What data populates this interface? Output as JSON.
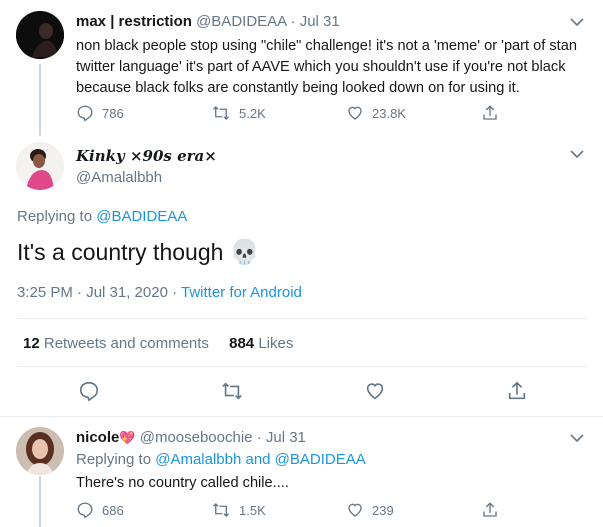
{
  "tweet1": {
    "name": "max | restriction",
    "handle": "@BADIDEAA",
    "dot": "·",
    "date": "Jul 31",
    "text": "non black people stop using \"chile\" challenge! it's not a 'meme' or 'part of stan twitter language' it's part of AAVE which you shouldn't use if you're not black because black folks are constantly being looked down on for using it.",
    "replies": "786",
    "retweets": "5.2K",
    "likes": "23.8K"
  },
  "main": {
    "name": "Kinky ×90s era×",
    "handle": "@Amalalbbh",
    "replying_prefix": "Replying to",
    "replying_handle": "@BADIDEAA",
    "text": "It's a country though",
    "emoji": "💀",
    "timestamp": "3:25 PM · Jul 31, 2020 · ",
    "source": "Twitter for Android",
    "retweets_count": "12",
    "retweets_label": "Retweets and comments",
    "likes_count": "884",
    "likes_label": "Likes"
  },
  "tweet3": {
    "name": "nicole",
    "heart": "💖",
    "handle": "@mooseboochie",
    "dot": "·",
    "date": "Jul 31",
    "replying_prefix": "Replying to",
    "replying_handles": "@Amalalbbh and @BADIDEAA",
    "text": "There's no country called chile....",
    "replies": "686",
    "retweets": "1.5K",
    "likes": "239"
  },
  "colors": {
    "link": "#1b95e0",
    "muted": "#657786",
    "text": "#14171a",
    "divider": "#e6ecf0"
  }
}
